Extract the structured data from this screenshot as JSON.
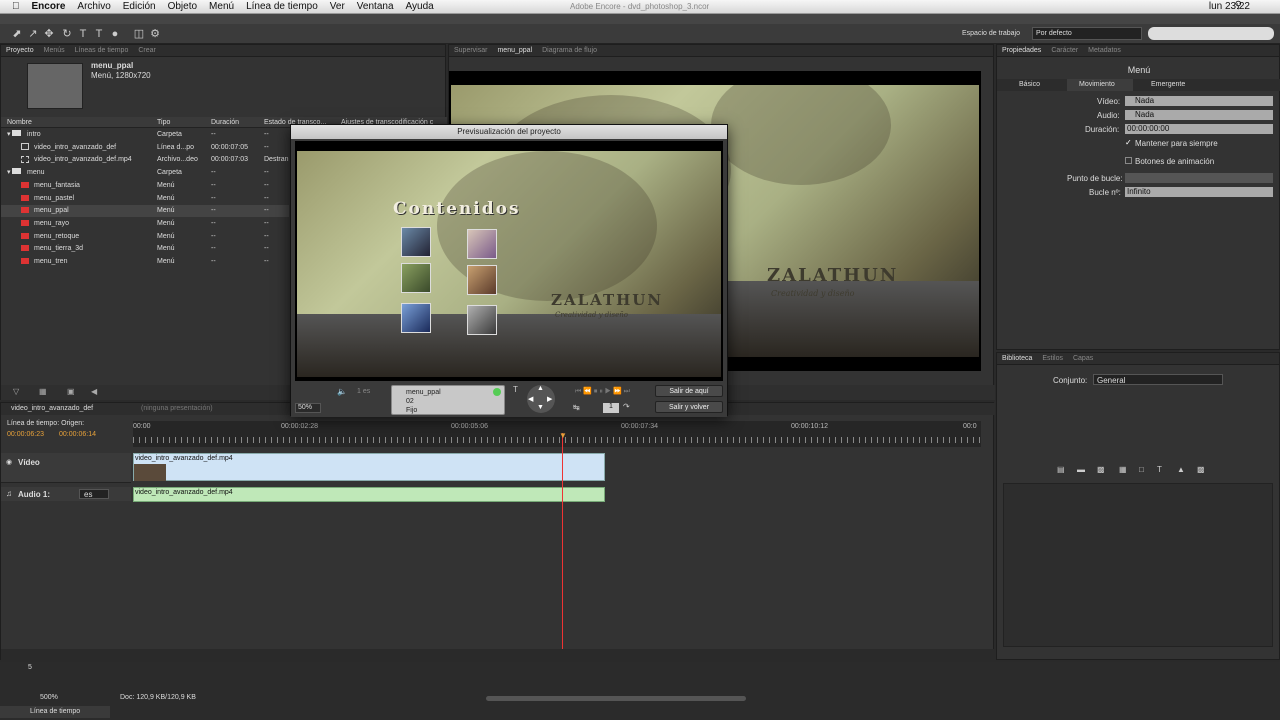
{
  "menubar": {
    "app": "Encore",
    "items": [
      "Archivo",
      "Edición",
      "Objeto",
      "Menú",
      "Línea de tiempo",
      "Ver",
      "Ventana",
      "Ayuda"
    ],
    "window_title": "Adobe Encore - dvd_photoshop_3.ncor",
    "clock": "lun 23:22"
  },
  "workspace": {
    "label": "Espacio de trabajo",
    "value": "Por defecto"
  },
  "project_panel": {
    "tabs": [
      "Proyecto",
      "Menús",
      "Líneas de tiempo",
      "Crear"
    ],
    "asset_name": "menu_ppal",
    "asset_info": "Menú, 1280x720",
    "columns": [
      "Nombre",
      "Tipo",
      "Duración",
      "Estado de transco...",
      "Ajustes de transcodificación c"
    ],
    "rows": [
      {
        "name": "intro",
        "type": "Carpeta",
        "dur": "--",
        "state": "--",
        "kind": "folder"
      },
      {
        "name": "video_intro_avanzado_def",
        "type": "Línea d...po",
        "dur": "00:00:07:05",
        "state": "--",
        "kind": "timeline"
      },
      {
        "name": "video_intro_avanzado_def.mp4",
        "type": "Archivo...deo",
        "dur": "00:00:07:03",
        "state": "Destran",
        "kind": "video"
      },
      {
        "name": "menu",
        "type": "Carpeta",
        "dur": "--",
        "state": "--",
        "kind": "folder"
      },
      {
        "name": "menu_fantasia",
        "type": "Menú",
        "dur": "--",
        "state": "--",
        "kind": "menu"
      },
      {
        "name": "menu_pastel",
        "type": "Menú",
        "dur": "--",
        "state": "--",
        "kind": "menu"
      },
      {
        "name": "menu_ppal",
        "type": "Menú",
        "dur": "--",
        "state": "--",
        "kind": "menu"
      },
      {
        "name": "menu_rayo",
        "type": "Menú",
        "dur": "--",
        "state": "--",
        "kind": "menu"
      },
      {
        "name": "menu_retoque",
        "type": "Menú",
        "dur": "--",
        "state": "--",
        "kind": "menu"
      },
      {
        "name": "menu_tierra_3d",
        "type": "Menú",
        "dur": "--",
        "state": "--",
        "kind": "menu"
      },
      {
        "name": "menu_tren",
        "type": "Menú",
        "dur": "--",
        "state": "--",
        "kind": "menu"
      }
    ]
  },
  "viewer": {
    "tabs": [
      "Supervisar",
      "menu_ppal",
      "Diagrama de flujo"
    ],
    "logo": "ZALATHUN",
    "tagline": "Creatividad y diseño"
  },
  "preview": {
    "title": "Previsualización del proyecto",
    "heading": "Contenidos",
    "logo": "ZALATHUN",
    "tagline": "Creatividad y diseño",
    "zoom": "50%",
    "lang": "1 es",
    "info_name": "menu_ppal",
    "info_num": "02",
    "info_mode": "Fijo",
    "page": "1",
    "exit_here": "Salir de aquí",
    "exit_return": "Salir y volver"
  },
  "properties": {
    "tabs": [
      "Propiedades",
      "Carácter",
      "Metadatos"
    ],
    "title": "Menú",
    "subtabs": [
      "Básico",
      "Movimiento",
      "Emergente"
    ],
    "video_label": "Vídeo:",
    "video_value": "Nada",
    "audio_label": "Audio:",
    "audio_value": "Nada",
    "duration_label": "Duración:",
    "duration_value": "00:00:00:00",
    "keep_forever": "Mantener para siempre",
    "anim_buttons": "Botones de animación",
    "loop_point": "Punto de bucle:",
    "loop_n_label": "Bucle nº:",
    "loop_n_value": "Infinito"
  },
  "library": {
    "tabs": [
      "Biblioteca",
      "Estilos",
      "Capas"
    ],
    "set_label": "Conjunto:",
    "set_value": "General"
  },
  "timeline": {
    "name": "video_intro_avanzado_def",
    "presentation": "(ninguna presentación)",
    "origin_label": "Línea de tiempo: Origen:",
    "tc1": "00:00:06:23",
    "tc2": "00:00:06:14",
    "ruler": [
      "00:00",
      "00:00:02:28",
      "00:00:05:06",
      "00:00:07:34",
      "00:00:10:12",
      "00:0"
    ],
    "video_track": "Vídeo",
    "video_clip": "video_intro_avanzado_def.mp4",
    "audio_track": "Audio 1:",
    "audio_lang": "es",
    "audio_clip": "video_intro_avanzado_def.mp4"
  },
  "status": {
    "zoom": "500%",
    "doc": "Doc: 120,9 KB/120,9 KB",
    "tab": "Línea de tiempo",
    "num": "5"
  }
}
